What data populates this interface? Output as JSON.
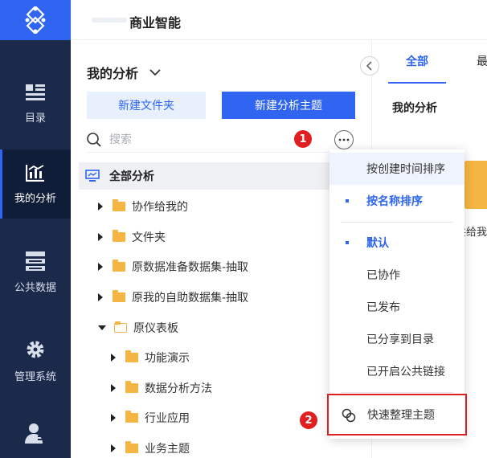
{
  "header": {
    "brand": "商业智能"
  },
  "nav": {
    "items": [
      {
        "label": "目录",
        "icon": "catalog-icon"
      },
      {
        "label": "我的分析",
        "icon": "chart-icon"
      },
      {
        "label": "公共数据",
        "icon": "database-icon"
      },
      {
        "label": "管理系统",
        "icon": "gear-icon"
      },
      {
        "label": "",
        "icon": "user-icon"
      }
    ],
    "active": "我的分析"
  },
  "panel": {
    "title": "我的分析",
    "new_folder_label": "新建文件夹",
    "new_theme_label": "新建分析主题",
    "search_placeholder": "搜索",
    "badge1": "1",
    "badge2": "2",
    "tree": {
      "root": "全部分析",
      "items": [
        {
          "label": "协作给我的"
        },
        {
          "label": "文件夹"
        },
        {
          "label": "原数据准备数据集-抽取"
        },
        {
          "label": "原我的自助数据集-抽取"
        },
        {
          "label": "原仪表板"
        },
        {
          "label": "功能演示"
        },
        {
          "label": "数据分析方法"
        },
        {
          "label": "行业应用"
        },
        {
          "label": "业务主题"
        }
      ]
    }
  },
  "content": {
    "tab_all": "全部",
    "tab_next": "最",
    "section_title": "我的分析",
    "card_text": "共给我"
  },
  "menu": {
    "sort_time": "按创建时间排序",
    "sort_name": "按名称排序",
    "filter_default": "默认",
    "filter_shared": "已协作",
    "filter_published": "已发布",
    "filter_catalog": "已分享到目录",
    "filter_public": "已开启公共链接",
    "quick_organize": "快速整理主题"
  },
  "colors": {
    "accent": "#2f65f0",
    "nav_bg": "#1b2a4a",
    "highlight_red": "#e02020",
    "folder": "#f5b543"
  }
}
